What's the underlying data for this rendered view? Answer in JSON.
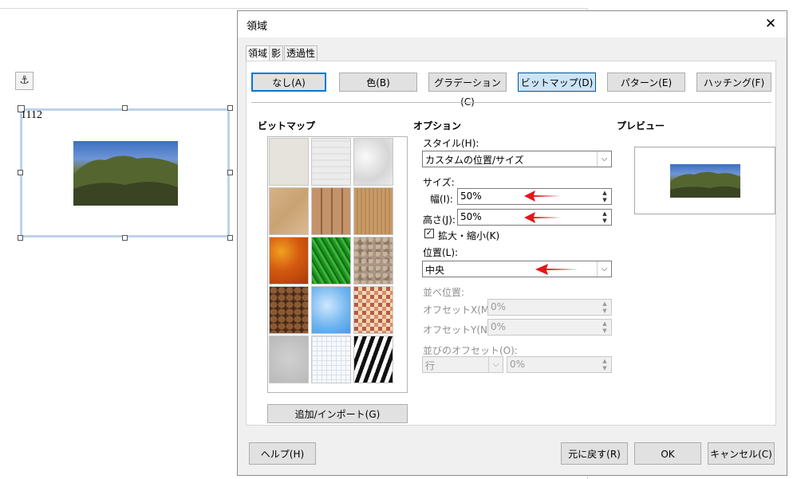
{
  "doc": {
    "anchor_glyph": "⚓",
    "frame_label": "1112"
  },
  "dialog": {
    "title": "領域",
    "close_glyph": "✕",
    "tabs": [
      "領域",
      "影",
      "透過性"
    ],
    "fill_buttons": [
      "なし(A)",
      "色(B)",
      "グラデーション(C)",
      "ビットマップ(D)",
      "パターン(E)",
      "ハッチング(F)"
    ],
    "active_fill": "ビットマップ(D)",
    "bitmap_header": "ビットマップ",
    "options_header": "オプション",
    "preview_header": "プレビュー",
    "add_import_label": "追加/インポート(G)",
    "style_label": "スタイル(H):",
    "style_value": "カスタムの位置/サイズ",
    "size_label": "サイズ:",
    "width_label": "幅(I):",
    "width_value": "50%",
    "height_label": "高さ(J):",
    "height_value": "50%",
    "scale_label": "拡大・縮小(K)",
    "scale_checked": true,
    "position_label": "位置(L):",
    "position_value": "中央",
    "tiling_position_label": "並べ位置:",
    "offset_x_label": "オフセットX(M):",
    "offset_x_value": "0%",
    "offset_y_label": "オフセットY(N):",
    "offset_y_value": "0%",
    "tiling_offset_label": "並びのオフセット(O):",
    "tiling_offset_mode": "行",
    "tiling_offset_value": "0%",
    "help_label": "ヘルプ(H)",
    "reset_label": "元に戻す(R)",
    "ok_label": "OK",
    "cancel_label": "キャンセル(C)",
    "arrow_color": "#e8141b",
    "tiles": [
      "painted-white",
      "paper",
      "crumpled-paper",
      "parchment",
      "wood-planks",
      "cardboard",
      "autumn-leaves",
      "grass",
      "pebbles",
      "coffee-beans",
      "clouds",
      "mosaic-tiles",
      "concrete",
      "graph-paper",
      "zebra"
    ]
  }
}
